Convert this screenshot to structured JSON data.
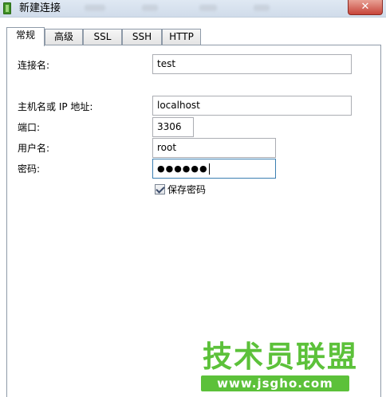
{
  "window": {
    "title": "新建连接",
    "close_glyph": "✕"
  },
  "tabs": [
    {
      "label": "常规",
      "active": true
    },
    {
      "label": "高级",
      "active": false
    },
    {
      "label": "SSL",
      "active": false
    },
    {
      "label": "SSH",
      "active": false
    },
    {
      "label": "HTTP",
      "active": false
    }
  ],
  "form": {
    "connection_name": {
      "label": "连接名:",
      "value": "test"
    },
    "host": {
      "label": "主机名或 IP 地址:",
      "value": "localhost"
    },
    "port": {
      "label": "端口:",
      "value": "3306"
    },
    "username": {
      "label": "用户名:",
      "value": "root"
    },
    "password": {
      "label": "密码:",
      "value": "●●●●●●"
    },
    "save_password": {
      "label": "保存密码",
      "checked": true
    }
  },
  "watermark": {
    "title": "技术员联盟",
    "url": "www.jsgho.com"
  },
  "colors": {
    "watermark_green": "#5cc13a",
    "close_red": "#c7453a"
  }
}
